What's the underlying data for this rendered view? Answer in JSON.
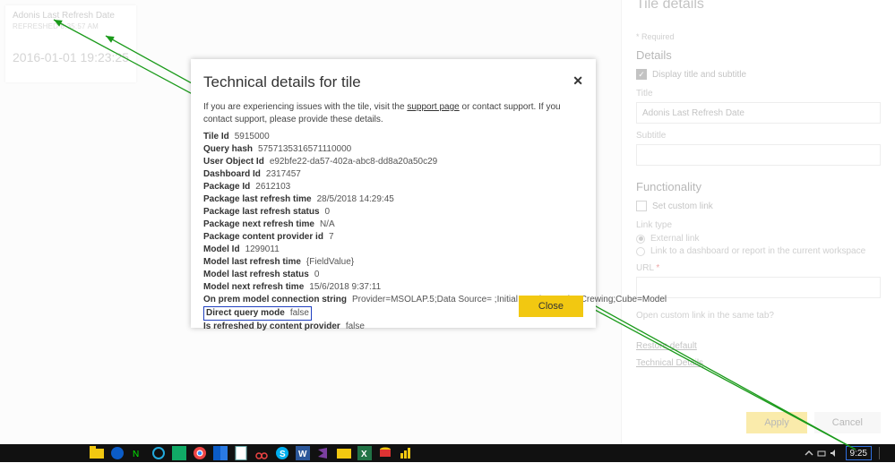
{
  "tile": {
    "title": "Adonis Last Refresh Date",
    "refreshed": "REFRESHED  8:35:57 AM",
    "value": "2016-01-01 19:23:25"
  },
  "modal": {
    "title": "Technical details for tile",
    "intro_pre": "If you are experiencing issues with the tile, visit the ",
    "intro_link": "support page",
    "intro_post": " or contact support. If you contact support, please provide these details.",
    "rows": {
      "tile_id": {
        "k": "Tile Id",
        "v": "5915000"
      },
      "query_hash": {
        "k": "Query hash",
        "v": "5757135316571110000"
      },
      "user_obj": {
        "k": "User Object Id",
        "v": "e92bfe22-da57-402a-abc8-dd8a20a50c29"
      },
      "dash_id": {
        "k": "Dashboard Id",
        "v": "2317457"
      },
      "pkg_id": {
        "k": "Package Id",
        "v": "2612103"
      },
      "pkg_last_rt": {
        "k": "Package last refresh time",
        "v": "28/5/2018 14:29:45"
      },
      "pkg_last_rs": {
        "k": "Package last refresh status",
        "v": "0"
      },
      "pkg_next_rt": {
        "k": "Package next refresh time",
        "v": "N/A"
      },
      "pkg_cpi": {
        "k": "Package content provider id",
        "v": "7"
      },
      "model_id": {
        "k": "Model Id",
        "v": "1299011"
      },
      "model_lrt": {
        "k": "Model last refresh time",
        "v": "{FieldValue}"
      },
      "model_lrs": {
        "k": "Model last refresh status",
        "v": "0"
      },
      "model_nrt": {
        "k": "Model next refresh time",
        "v": "15/6/2018 9:37:11"
      },
      "onprem": {
        "k": "On prem model connection string",
        "v": "Provider=MSOLAP.5;Data Source=                     ;Initial Catalog=Cube Crewing;Cube=Model"
      },
      "dq": {
        "k": "Direct query mode",
        "v": "false"
      },
      "isref": {
        "k": "Is refreshed by content provider",
        "v": "false"
      }
    },
    "close_btn": "Close"
  },
  "panel": {
    "title": "Tile details",
    "required": "* Required",
    "section_details": "Details",
    "display_sub": "Display title and subtitle",
    "title_lbl": "Title",
    "title_val": "Adonis Last Refresh Date",
    "subtitle_lbl": "Subtitle",
    "subtitle_val": "",
    "section_func": "Functionality",
    "set_custom": "Set custom link",
    "link_type": "Link type",
    "ext_link": "External link",
    "link_dash": "Link to a dashboard or report in the current workspace",
    "url_lbl": "URL",
    "open_same": "Open custom link in the same tab?",
    "restore": "Restore default",
    "tech_details": "Technical Details",
    "apply": "Apply",
    "cancel": "Cancel"
  },
  "taskbar": {
    "clock": "9:25"
  }
}
